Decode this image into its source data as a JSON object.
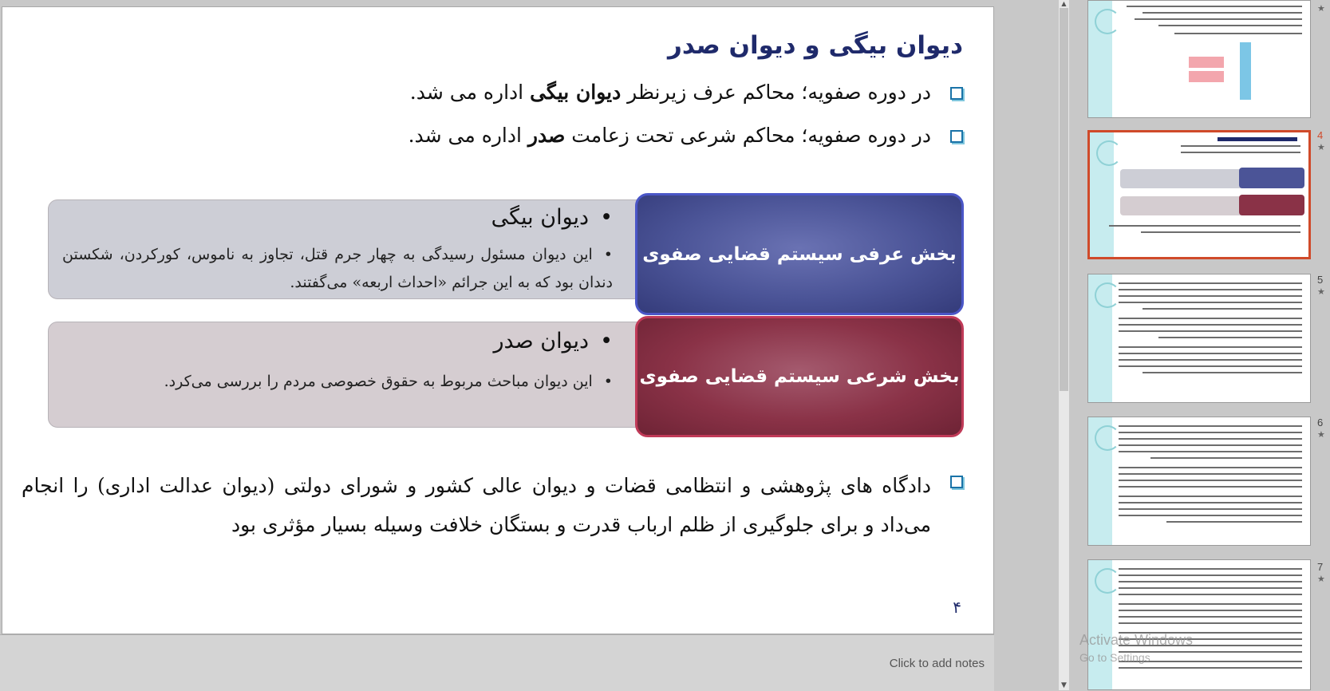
{
  "slide": {
    "title": "دیوان بیگی و دیوان صدر",
    "bullets": [
      {
        "pre": "در دوره صفویه؛ محاکم عرف زیرنظر ",
        "bold": "دیوان بیگی",
        "post": " اداره می شد."
      },
      {
        "pre": "در دوره صفویه؛ محاکم شرعی تحت زعامت ",
        "bold": "صدر",
        "post": " اداره می شد."
      }
    ],
    "sections": [
      {
        "banner": "بخش عرفی سیستم قضایی صفوی",
        "heading": "دیوان بیگی",
        "detail": "این دیوان مسئول رسیدگی به چهار جرم قتل، تجاوز به ناموس، کورکردن، شکستن دندان بود که به این جرائم «احداث اربعه» می‌گفتند."
      },
      {
        "banner": "بخش شرعی سیستم قضایی صفوی",
        "heading": "دیوان صدر",
        "detail": "این دیوان مباحث مربوط به حقوق خصوصی مردم را بررسی می‌کرد."
      }
    ],
    "bottom_paragraph": "دادگاه های پژوهشی و انتظامی قضات و دیوان عالی کشور و شورای دولتی (دیوان عدالت اداری) را انجام می‌داد و برای جلوگیری از ظلم ارباب قدرت و بستگان خلافت وسیله بسیار مؤثری بود",
    "number": "۴",
    "bullet_marker": "•"
  },
  "notes": {
    "placeholder": "Click to add notes"
  },
  "thumbnails": [
    {
      "number": "",
      "star": "★",
      "selected": false
    },
    {
      "number": "4",
      "star": "★",
      "selected": true
    },
    {
      "number": "5",
      "star": "★",
      "selected": false
    },
    {
      "number": "6",
      "star": "★",
      "selected": false
    },
    {
      "number": "7",
      "star": "★",
      "selected": false
    }
  ],
  "watermark": {
    "line1": "Activate Windows",
    "line2": "Go to Settings"
  },
  "colors": {
    "title": "#1f2a6b",
    "banner_blue": "#4b5497",
    "banner_red": "#8a3247",
    "selected_border": "#d04a2a",
    "accent_teal": "#c7ecef"
  }
}
